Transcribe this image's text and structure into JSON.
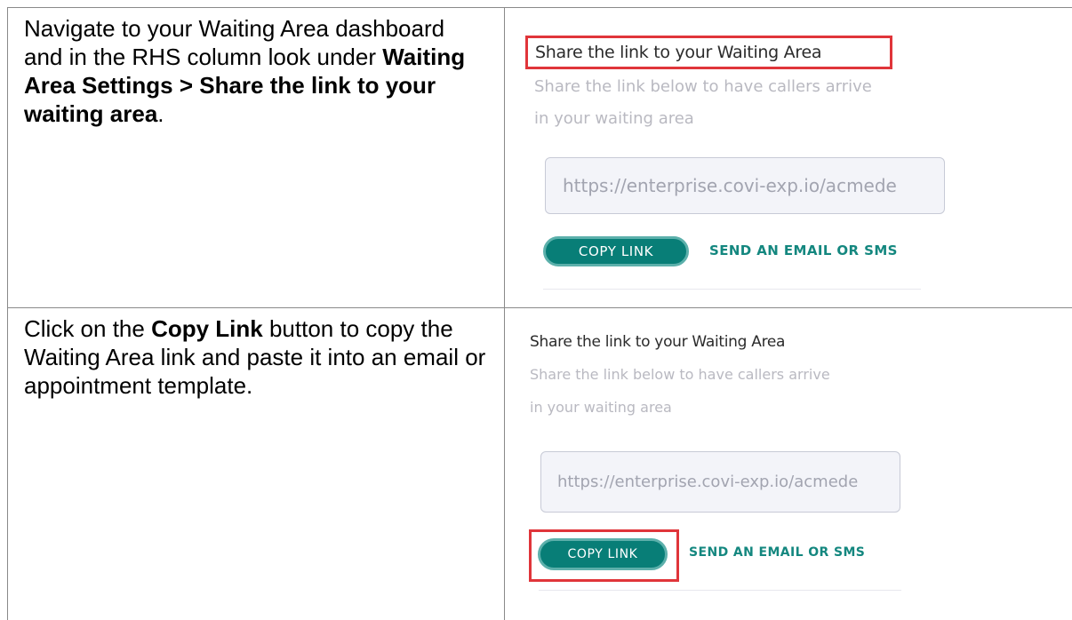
{
  "rows": [
    {
      "instruction": {
        "part1": "Navigate to your Waiting Area dashboard and in the RHS column look under ",
        "bold1": "Waiting Area Settings > Share the link to your waiting area",
        "part2": "."
      },
      "screenshot": {
        "title": "Share the link to your Waiting Area",
        "description_line1": "Share the link below to have callers arrive",
        "description_line2": "in your waiting area",
        "link_value": "https://enterprise.covi-exp.io/acmede",
        "copy_button": "COPY LINK",
        "send_link": "SEND AN EMAIL OR SMS",
        "highlight": "title"
      }
    },
    {
      "instruction": {
        "part1": "Click on the ",
        "bold1": "Copy Link",
        "part2": " button to copy the Waiting Area link and paste it into an email or appointment template."
      },
      "screenshot": {
        "title": "Share the link to your Waiting Area",
        "description_line1": "Share the link below to have callers arrive",
        "description_line2": "in your waiting area",
        "link_value": "https://enterprise.covi-exp.io/acmede",
        "copy_button": "COPY LINK",
        "send_link": "SEND AN EMAIL OR SMS",
        "highlight": "copy-button"
      }
    }
  ],
  "colors": {
    "highlight": "#e0353a",
    "accent": "#087e77",
    "link_text": "#14877f"
  }
}
